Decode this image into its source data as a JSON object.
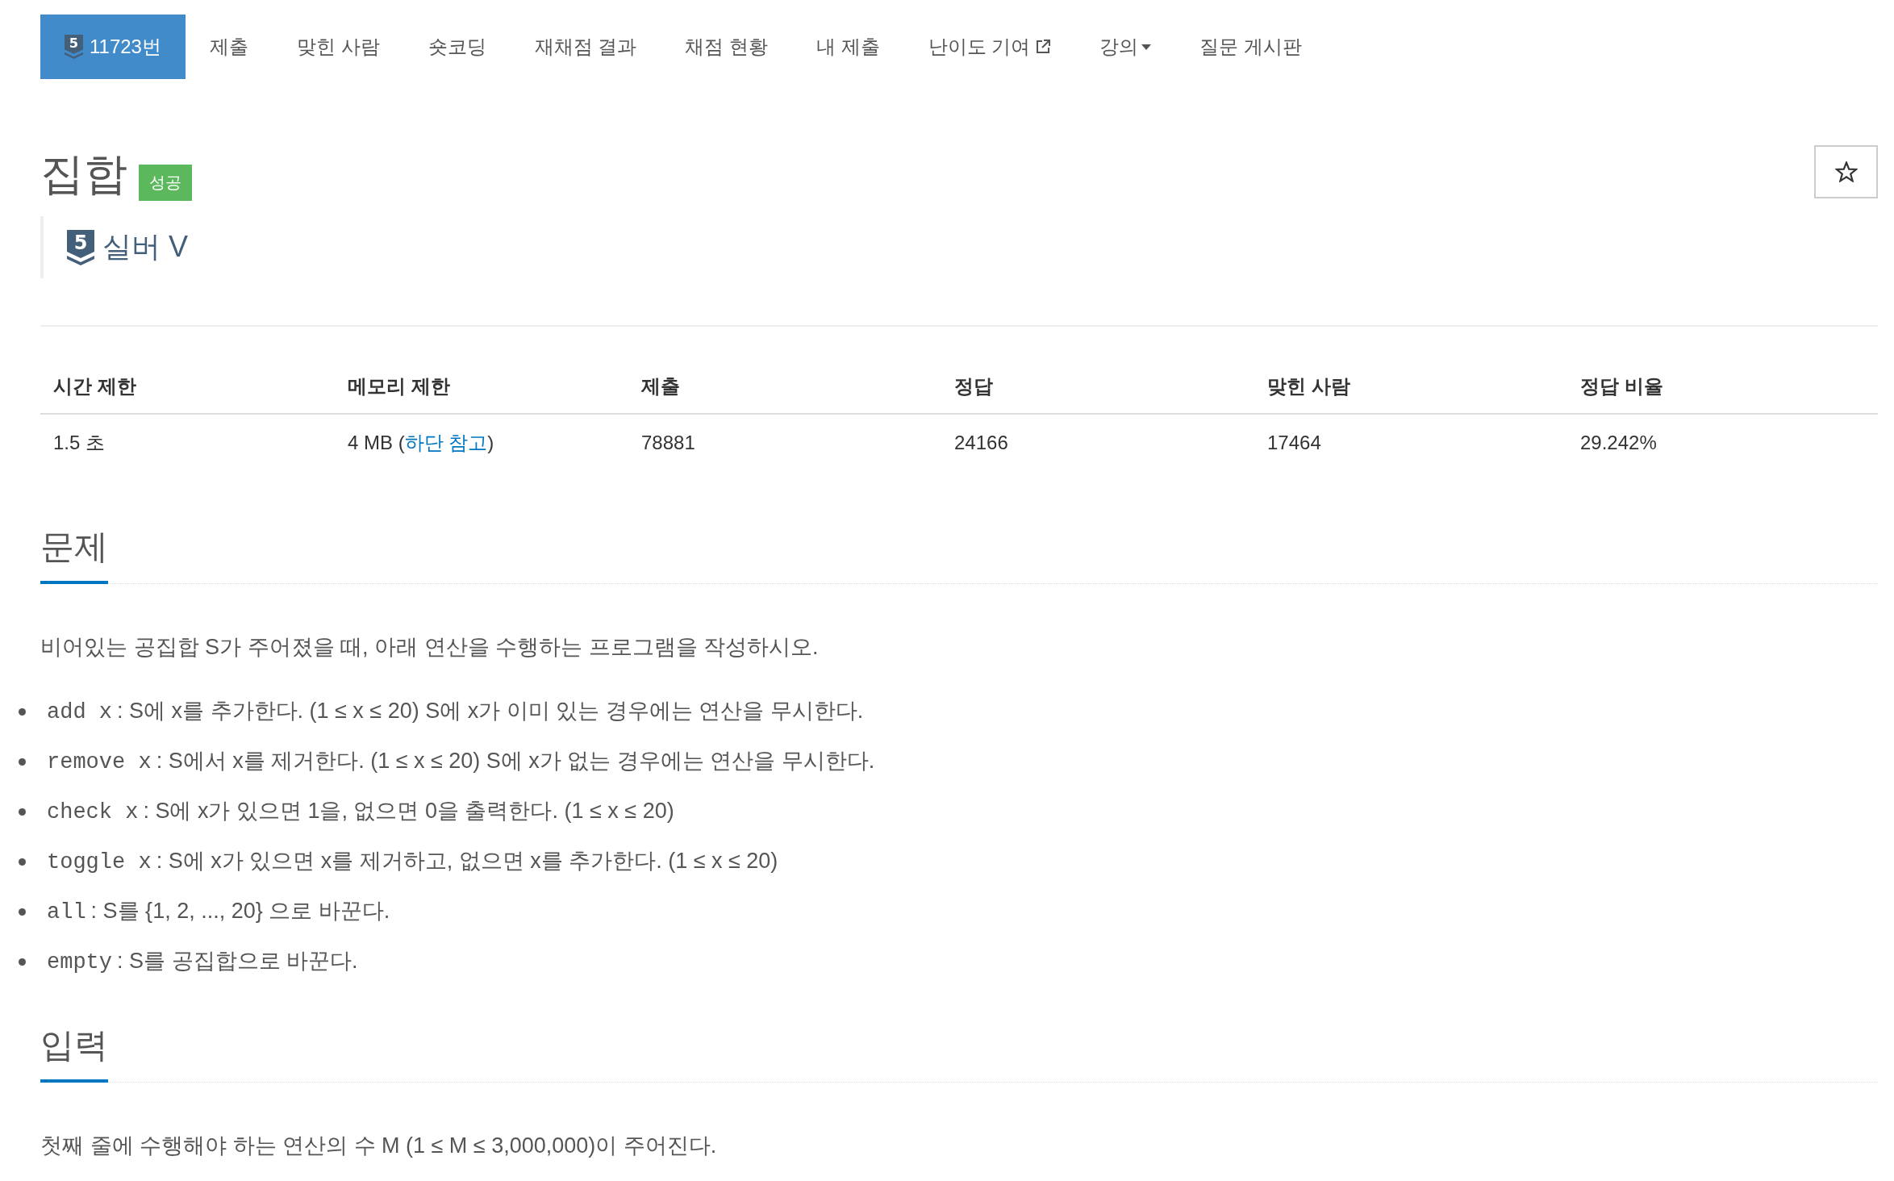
{
  "nav": {
    "tabs": [
      {
        "kind": "problem",
        "badge": "5",
        "label": "11723번",
        "selected": true
      },
      {
        "kind": "link",
        "label": "제출",
        "selected": false
      },
      {
        "kind": "link",
        "label": "맞힌 사람",
        "selected": false
      },
      {
        "kind": "link",
        "label": "숏코딩",
        "selected": false
      },
      {
        "kind": "link",
        "label": "재채점 결과",
        "selected": false
      },
      {
        "kind": "link",
        "label": "채점 현황",
        "selected": false
      },
      {
        "kind": "link",
        "label": "내 제출",
        "selected": false
      },
      {
        "kind": "external",
        "label": "난이도 기여",
        "selected": false
      },
      {
        "kind": "dropdown",
        "label": "강의",
        "selected": false
      },
      {
        "kind": "link",
        "label": "질문 게시판",
        "selected": false
      }
    ]
  },
  "problem": {
    "title": "집합",
    "result": {
      "label": "성공",
      "kind": "success"
    },
    "starred": false,
    "tier": {
      "badge": "5",
      "label": "실버 V"
    }
  },
  "table": {
    "columns": [
      "시간 제한",
      "메모리 제한",
      "제출",
      "정답",
      "맞힌 사람",
      "정답 비율"
    ],
    "rows": [
      {
        "cells": [
          {
            "text": "1.5 초"
          },
          {
            "text": "4 MB (",
            "link": "하단 참고",
            "after": ")"
          },
          {
            "text": "78881"
          },
          {
            "text": "24166"
          },
          {
            "text": "17464"
          },
          {
            "text": "29.242%"
          }
        ]
      }
    ]
  },
  "sections": [
    {
      "title": "문제",
      "paragraphs": [
        "비어있는 공집합 S가 주어졌을 때, 아래 연산을 수행하는 프로그램을 작성하시오."
      ],
      "operations": [
        {
          "code": "add x",
          "text": ": S에 x를 추가한다. (1 ≤ x ≤ 20) S에 x가 이미 있는 경우에는 연산을 무시한다."
        },
        {
          "code": "remove x",
          "text": ": S에서 x를 제거한다. (1 ≤ x ≤ 20) S에 x가 없는 경우에는 연산을 무시한다."
        },
        {
          "code": "check x",
          "text": ": S에 x가 있으면 1을, 없으면 0을 출력한다. (1 ≤ x ≤ 20)"
        },
        {
          "code": "toggle x",
          "text": ": S에 x가 있으면 x를 제거하고, 없으면 x를 추가한다. (1 ≤ x ≤ 20)"
        },
        {
          "code": "all",
          "text": ": S를 {1, 2, ..., 20} 으로 바꾼다."
        },
        {
          "code": "empty",
          "text": ": S를 공집합으로 바꾼다."
        }
      ]
    },
    {
      "title": "입력",
      "paragraphs": [
        "첫째 줄에 수행해야 하는 연산의 수 M (1 ≤ M ≤ 3,000,000)이 주어진다."
      ]
    }
  ]
}
